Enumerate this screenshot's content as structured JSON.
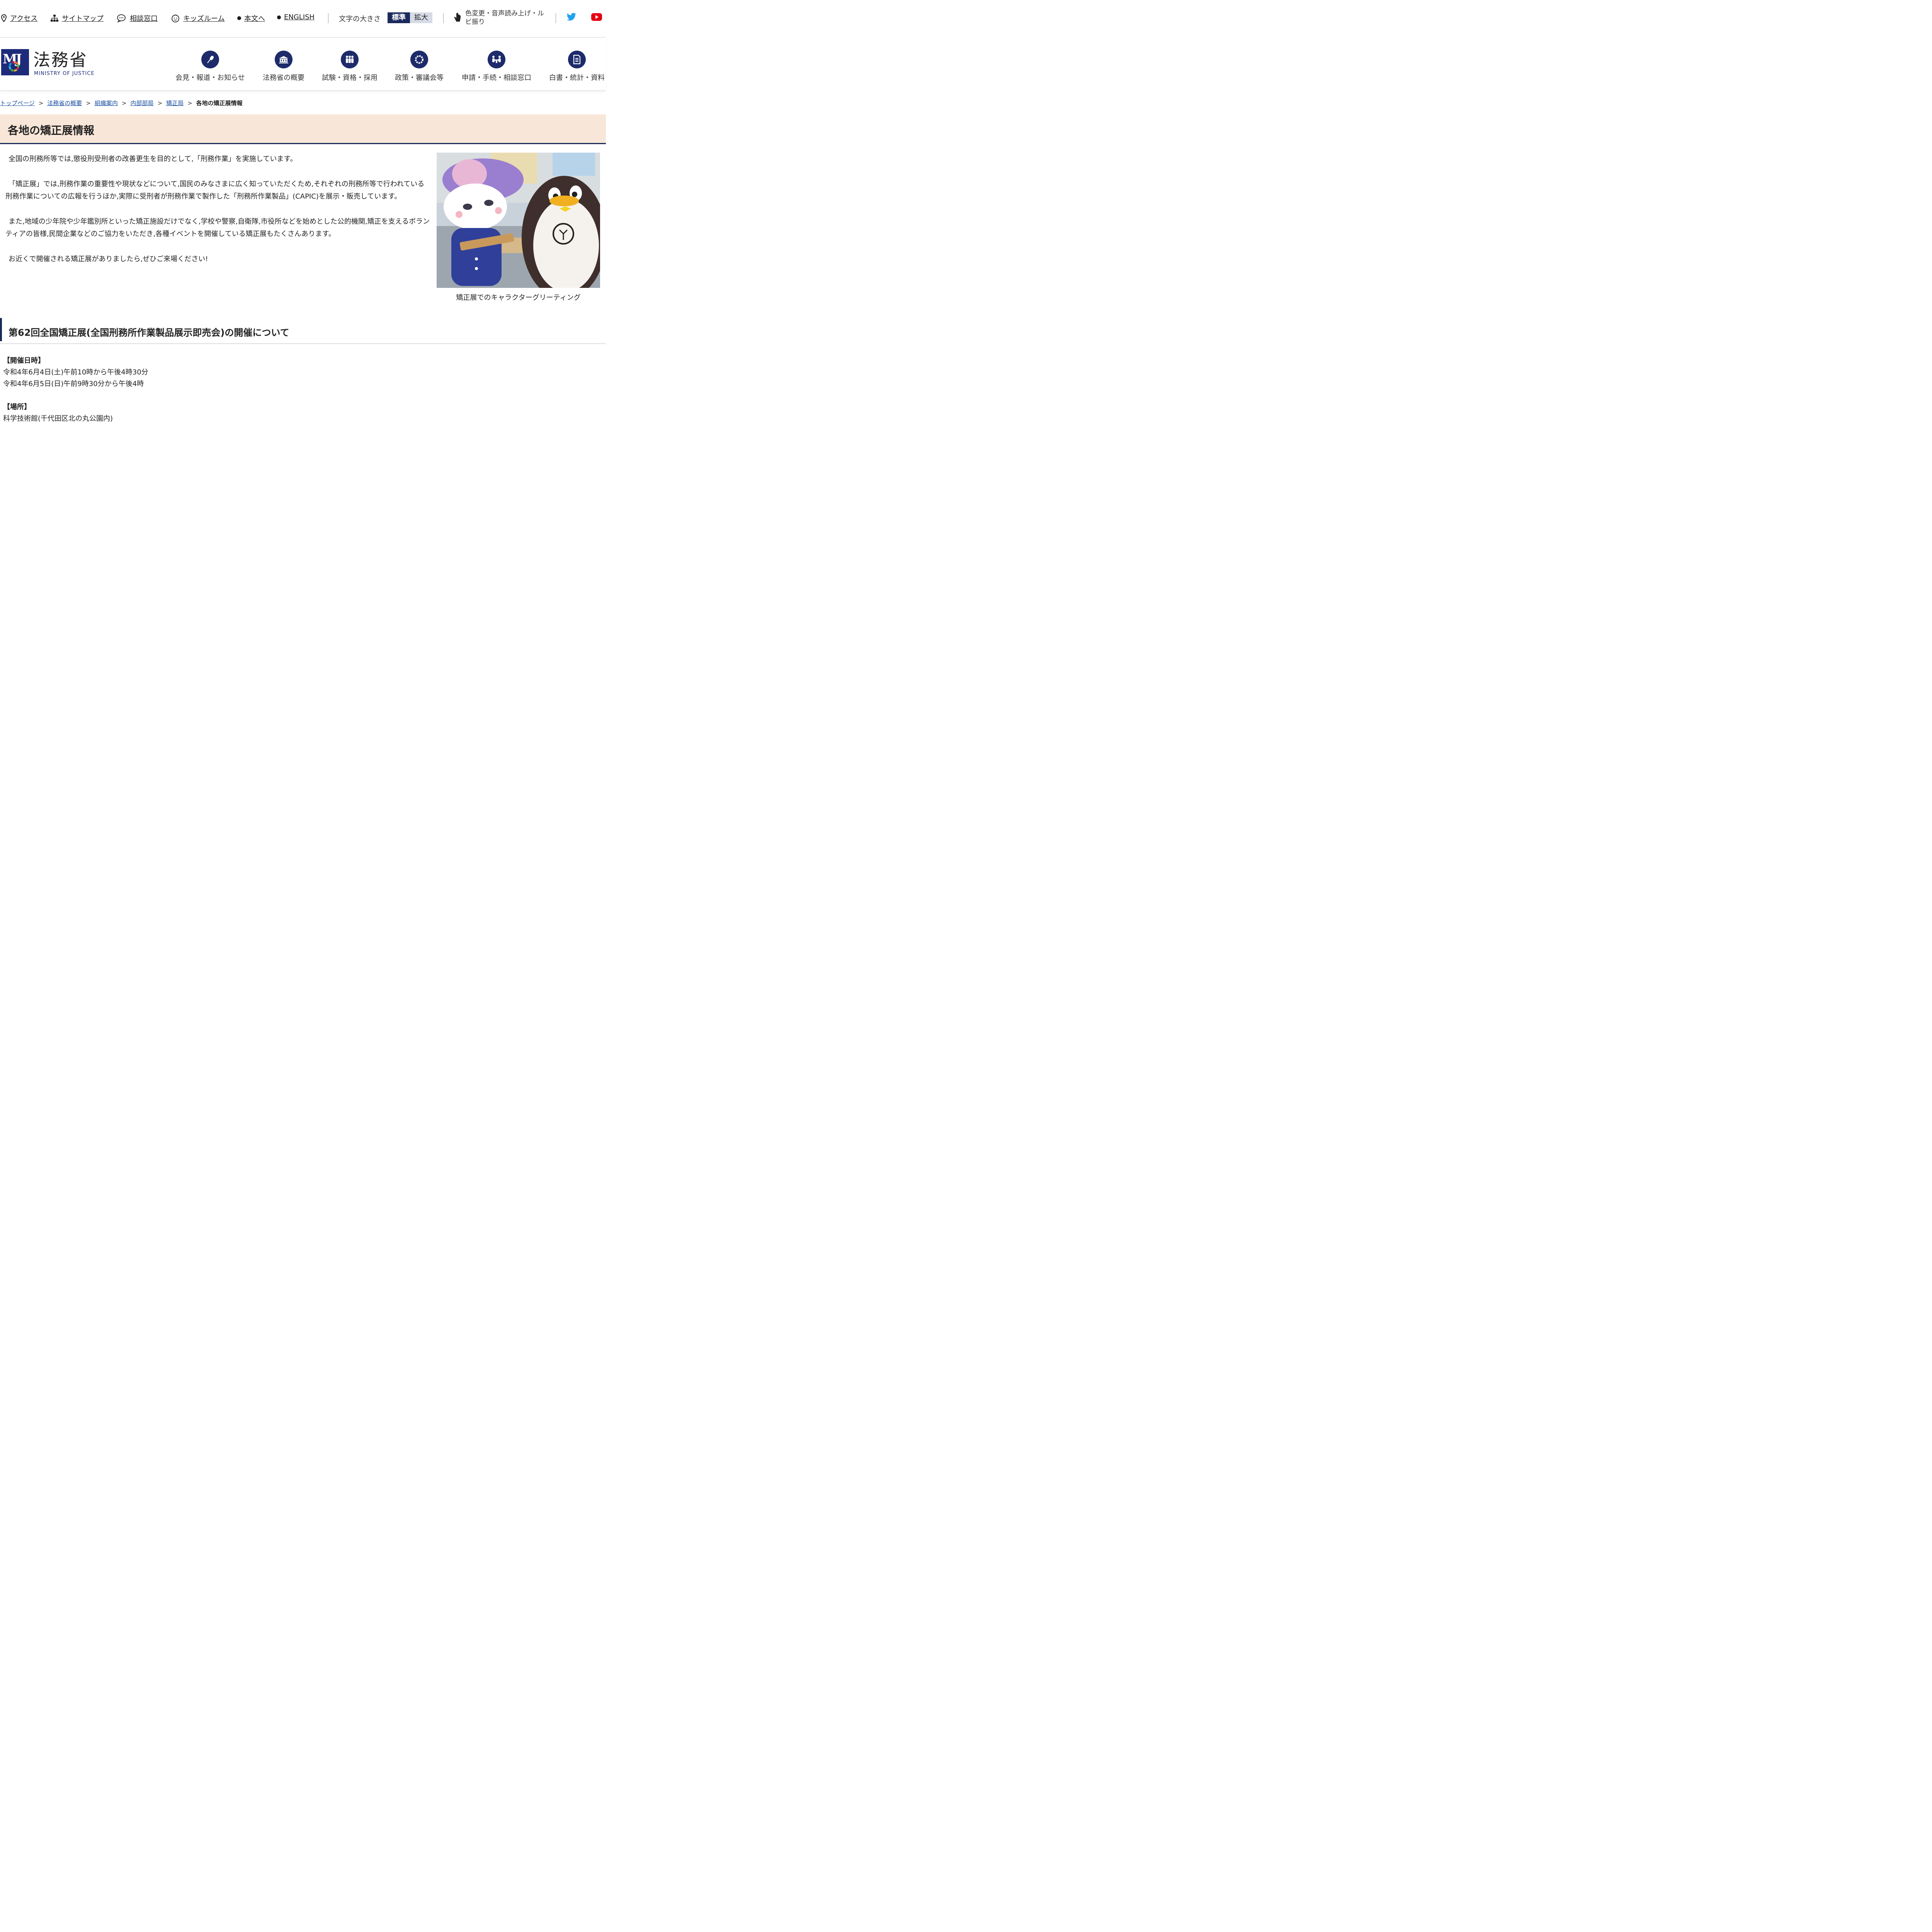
{
  "utility": {
    "access": "アクセス",
    "sitemap": "サイトマップ",
    "consult": "相談窓口",
    "kids": "キッズルーム",
    "main": "本文へ",
    "english": "ENGLISH",
    "font_size_label": "文字の大きさ",
    "font_std": "標準",
    "font_big": "拡大",
    "access_tools": "色変更・音声読み上げ・ルビ振り",
    "icons": [
      "location-pin-icon",
      "sitemap-icon",
      "chat-bubble-icon",
      "kids-face-icon",
      "accessibility-hand-icon",
      "twitter-icon",
      "youtube-icon"
    ],
    "colors": {
      "twitter": "#1da1f2",
      "youtube": "#e60012"
    }
  },
  "header": {
    "logo_jp": "法務省",
    "logo_en": "MINISTRY OF JUSTICE",
    "logo_mark": "MJ",
    "nav": [
      {
        "label": "会見・報道・お知らせ",
        "icon": "microphone-icon"
      },
      {
        "label": "法務省の概要",
        "icon": "building-icon"
      },
      {
        "label": "試験・資格・採用",
        "icon": "people-icon"
      },
      {
        "label": "政策・審議会等",
        "icon": "ring-icon"
      },
      {
        "label": "申請・手続・相談窓口",
        "icon": "meeting-icon"
      },
      {
        "label": "白書・統計・資料",
        "icon": "document-icon"
      }
    ]
  },
  "breadcrumb": {
    "items": [
      "トップページ",
      "法務省の概要",
      "組織案内",
      "内部部局",
      "矯正局"
    ],
    "current": "各地の矯正展情報",
    "separator": ">"
  },
  "page": {
    "title": "各地の矯正展情報",
    "paragraphs": [
      "全国の刑務所等では,懲役刑受刑者の改善更生を目的として,「刑務作業」を実施しています。",
      "「矯正展」では,刑務作業の重要性や現状などについて,国民のみなさまに広く知っていただくため,それぞれの刑務所等で行われている刑務作業についての広報を行うほか,実際に受刑者が刑務作業で製作した「刑務所作業製品」(CAPIC)を展示・販売しています。",
      "また,地域の少年院や少年鑑別所といった矯正施設だけでなく,学校や警察,自衛隊,市役所などを始めとした公的機関,矯正を支えるボランティアの皆様,民間企業などのご協力をいただき,各種イベントを開催している矯正展もたくさんあります。",
      "お近くで開催される矯正展がありましたら,ぜひご来場ください!"
    ],
    "photo_caption": "矯正展でのキャラクターグリーティング",
    "section_heading": "第62回全国矯正展(全国刑務所作業製品展示即売会)の開催について",
    "date_label": "【開催日時】",
    "dates": [
      "令和4年6月4日(土)午前10時から午後4時30分",
      "令和4年6月5日(日)午前9時30分から午後4時"
    ],
    "place_label": "【場所】",
    "place": "科学技術館(千代田区北の丸公園内)"
  }
}
